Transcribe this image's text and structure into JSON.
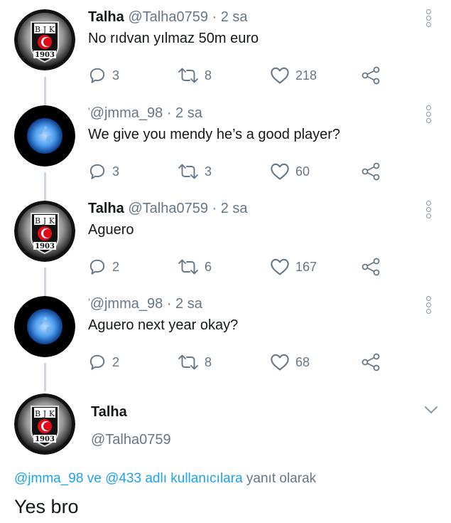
{
  "tweets": [
    {
      "name": "Talha",
      "handle": "@Talha0759",
      "time": "2 sa",
      "text": "No rıdvan yılmaz 50m euro",
      "avatar": "bjk-logo",
      "replies": "3",
      "retweets": "8",
      "likes": "218"
    },
    {
      "name": "",
      "handle": "@jmma_98",
      "time": "2 sa",
      "text": "We give you mendy he’s a good player?",
      "avatar": "blue-moon",
      "replies": "3",
      "retweets": "3",
      "likes": "60"
    },
    {
      "name": "Talha",
      "handle": "@Talha0759",
      "time": "2 sa",
      "text": "Aguero",
      "avatar": "bjk-logo",
      "replies": "2",
      "retweets": "6",
      "likes": "167"
    },
    {
      "name": "",
      "handle": "@jmma_98",
      "time": "2 sa",
      "text": "Aguero next year okay?",
      "avatar": "blue-moon",
      "replies": "2",
      "retweets": "8",
      "likes": "68"
    }
  ],
  "main_tweet": {
    "name": "Talha",
    "handle": "@Talha0759",
    "reply_to_user1": "@jmma_98",
    "reply_to_mid": " ve ",
    "reply_to_user2": "@433",
    "reply_to_suffix_link": " adlı kullanıcılara",
    "reply_to_suffix": " yanıt olarak",
    "text": "Yes bro"
  },
  "logo": {
    "letters": [
      "B",
      "J",
      "K"
    ],
    "year": "1903"
  },
  "colors": {
    "link": "#1da1f2",
    "muted": "#657786",
    "thread_line": "#cdd5dc",
    "icon": "#657786"
  },
  "icons": [
    "reply-icon",
    "retweet-icon",
    "like-icon",
    "share-icon",
    "more-icon",
    "chevron-down-icon"
  ]
}
